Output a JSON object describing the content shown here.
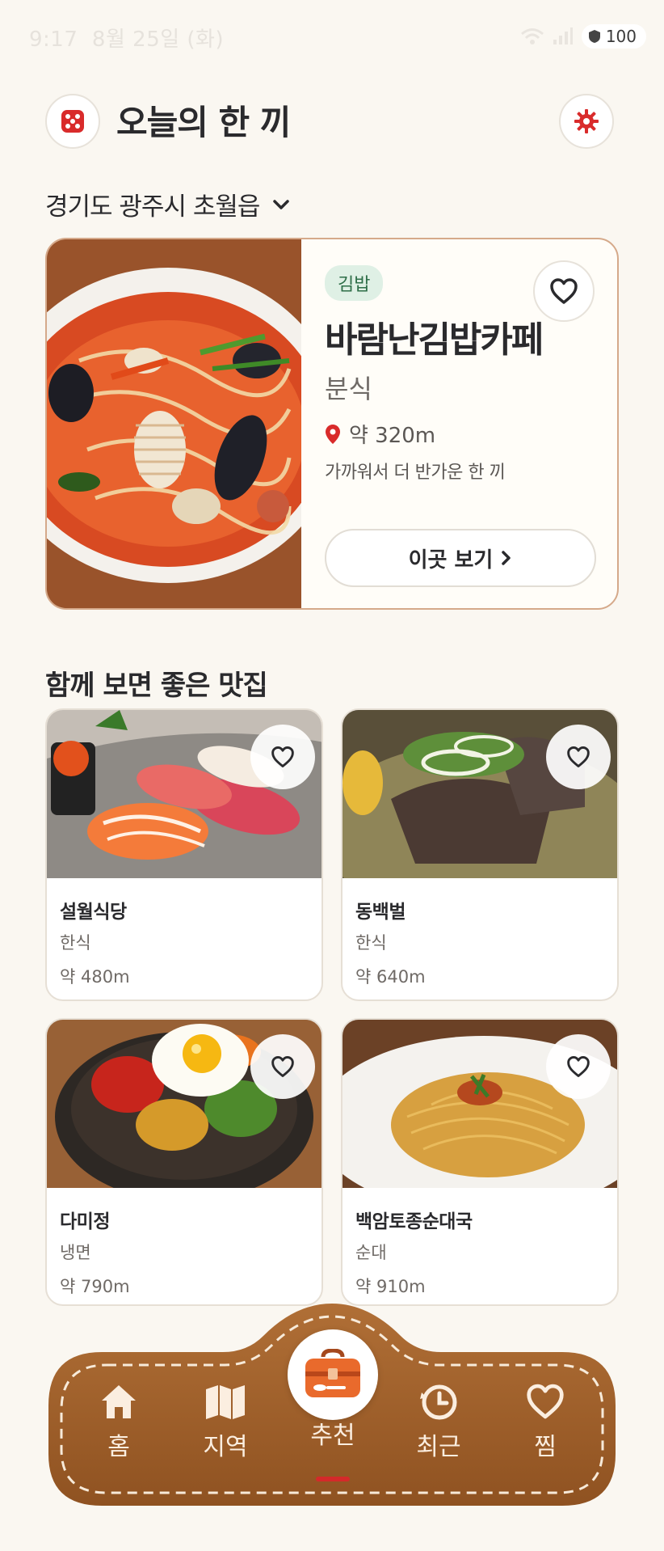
{
  "status_bar": {
    "time": "9:17",
    "date": "8월 25일 (화)",
    "battery": "100"
  },
  "header": {
    "title": "오늘의 한 끼",
    "dice_icon": "dice-icon",
    "settings_icon": "gear-icon"
  },
  "location": {
    "label": "경기도 광주시 초월읍"
  },
  "hero": {
    "tag": "김밥",
    "name": "바람난김밥카페",
    "category": "분식",
    "distance": "약 320m",
    "description": "가까워서 더 반가운 한 끼",
    "button_label": "이곳 보기"
  },
  "section": {
    "title": "함께 보면 좋은 맛집"
  },
  "cards": [
    {
      "name": "설월식당",
      "category": "한식",
      "distance": "약 480m"
    },
    {
      "name": "동백벌",
      "category": "한식",
      "distance": "약 640m"
    },
    {
      "name": "다미정",
      "category": "냉면",
      "distance": "약 790m"
    },
    {
      "name": "백암토종순대국",
      "category": "순대",
      "distance": "약 910m"
    }
  ],
  "nav": {
    "items": [
      {
        "label": "홈",
        "icon": "home-icon"
      },
      {
        "label": "지역",
        "icon": "map-icon"
      },
      {
        "label": "추천",
        "icon": "lunchbox-icon",
        "active": true
      },
      {
        "label": "최근",
        "icon": "clock-icon"
      },
      {
        "label": "찜",
        "icon": "heart-icon"
      }
    ]
  },
  "colors": {
    "accent": "#d42a2a",
    "background": "#faf7f1",
    "leather": "#a5632e",
    "tag_bg": "#dff0e5"
  }
}
